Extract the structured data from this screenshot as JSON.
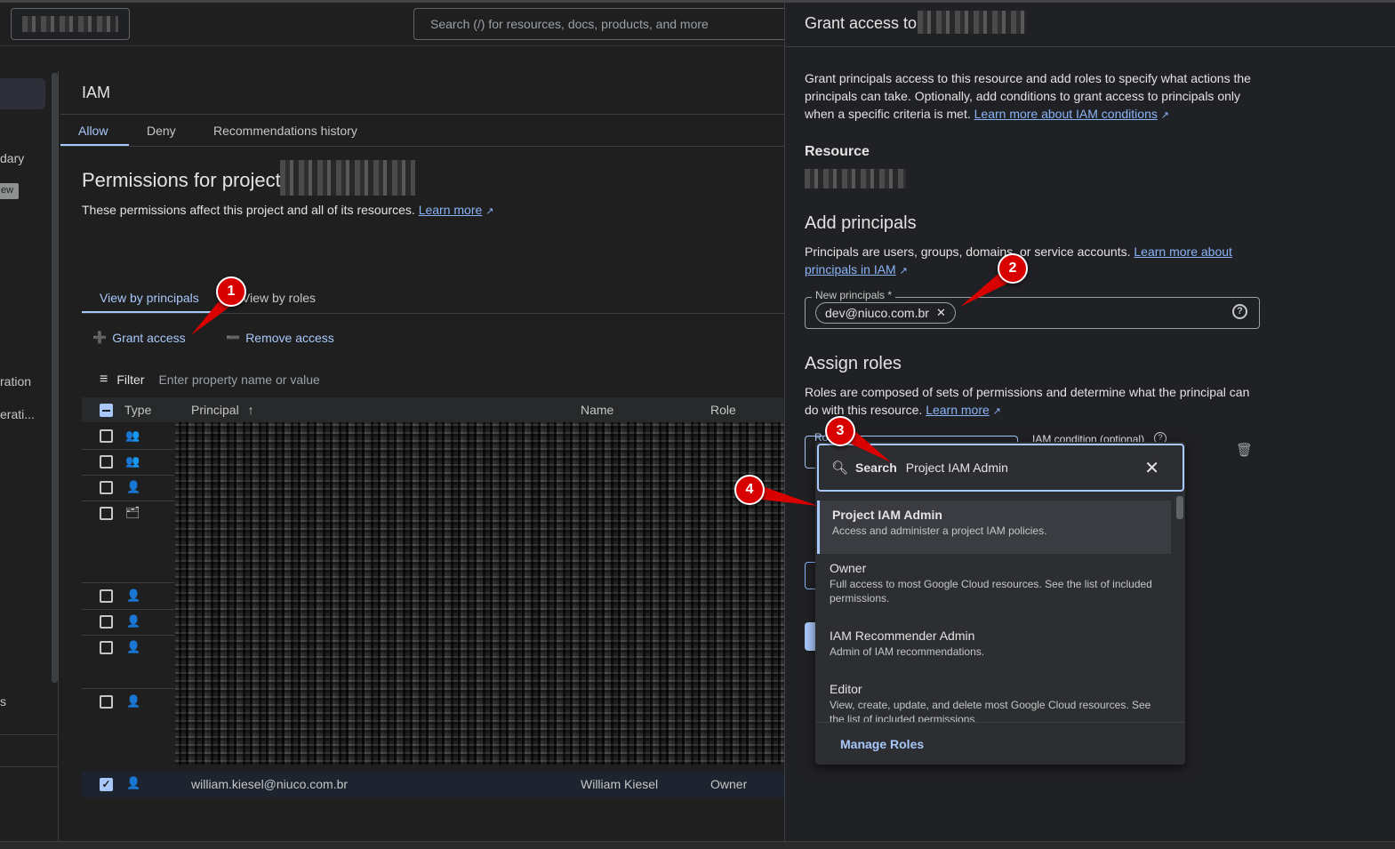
{
  "header": {
    "search_placeholder": "Search (/) for resources, docs, products, and more"
  },
  "sidebar": {
    "fragments": [
      "dary",
      "ew",
      "ration",
      "erati...",
      "s"
    ]
  },
  "iam": {
    "title": "IAM",
    "tabs": [
      "Allow",
      "Deny",
      "Recommendations history"
    ],
    "permissions_title": "Permissions for project",
    "permissions_desc": "These permissions affect this project and all of its resources.",
    "learn_more": "Learn more",
    "view_tabs": [
      "View by principals",
      "View by roles"
    ],
    "grant_access": "Grant access",
    "remove_access": "Remove access",
    "filter_label": "Filter",
    "filter_placeholder": "Enter property name or value",
    "columns": [
      "Type",
      "Principal",
      "Name",
      "Role"
    ],
    "last_row": {
      "principal": "william.kiesel@niuco.com.br",
      "name": "William Kiesel",
      "role": "Owner"
    }
  },
  "panel": {
    "title": "Grant access to",
    "intro": "Grant principals access to this resource and add roles to specify what actions the principals can take. Optionally, add conditions to grant access to principals only when a specific criteria is met.",
    "intro_link": "Learn more about IAM conditions",
    "resource_heading": "Resource",
    "add_principals_heading": "Add principals",
    "add_principals_desc": "Principals are users, groups, domains, or service accounts.",
    "add_principals_link": "Learn more about principals in IAM",
    "new_principals_label": "New principals *",
    "principal_chip": "dev@niuco.com.br",
    "assign_roles_heading": "Assign roles",
    "assign_roles_desc": "Roles are composed of sets of permissions and determine what the principal can do with this resource.",
    "assign_roles_link": "Learn more",
    "role_label_fragment": "Ro",
    "iam_condition_label": "IAM condition (optional)"
  },
  "dropdown": {
    "search_label": "Search",
    "search_value": "Project IAM Admin",
    "options": [
      {
        "title": "Project IAM Admin",
        "desc": "Access and administer a project IAM policies."
      },
      {
        "title": "Owner",
        "desc": "Full access to most Google Cloud resources. See the list of included permissions."
      },
      {
        "title": "IAM Recommender Admin",
        "desc": "Admin of IAM recommendations."
      },
      {
        "title": "Editor",
        "desc": "View, create, update, and delete most Google Cloud resources. See the list of included permissions."
      }
    ],
    "manage_roles": "Manage Roles"
  },
  "annotations": [
    "1",
    "2",
    "3",
    "4"
  ],
  "colors": {
    "accent": "#a8c7fa",
    "annotation_red": "#d90000",
    "background": "#1f1f1f"
  }
}
